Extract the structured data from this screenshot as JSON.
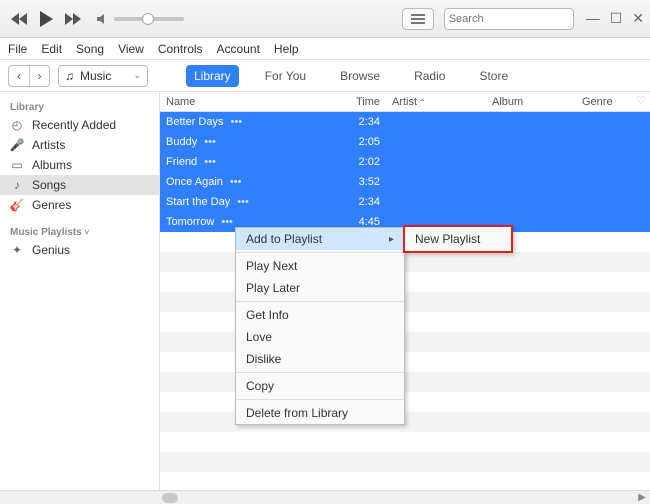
{
  "search": {
    "placeholder": "Search"
  },
  "menubar": [
    "File",
    "Edit",
    "Song",
    "View",
    "Controls",
    "Account",
    "Help"
  ],
  "source": {
    "label": "Music",
    "icon": "music-note-icon"
  },
  "tabs": [
    {
      "label": "Library",
      "active": true
    },
    {
      "label": "For You"
    },
    {
      "label": "Browse"
    },
    {
      "label": "Radio"
    },
    {
      "label": "Store"
    }
  ],
  "sidebar": {
    "sections": [
      {
        "header": "Library",
        "items": [
          {
            "icon": "clock-icon",
            "label": "Recently Added"
          },
          {
            "icon": "mic-icon",
            "label": "Artists"
          },
          {
            "icon": "album-icon",
            "label": "Albums"
          },
          {
            "icon": "note-icon",
            "label": "Songs",
            "active": true
          },
          {
            "icon": "guitar-icon",
            "label": "Genres"
          }
        ]
      },
      {
        "header": "Music Playlists",
        "collapsible": true,
        "items": [
          {
            "icon": "genius-icon",
            "label": "Genius"
          }
        ]
      }
    ]
  },
  "columns": {
    "name": "Name",
    "time": "Time",
    "artist": "Artist",
    "album": "Album",
    "genre": "Genre"
  },
  "sort_column": "artist",
  "tracks": [
    {
      "name": "Better Days",
      "time": "2:34",
      "selected": true
    },
    {
      "name": "Buddy",
      "time": "2:05",
      "selected": true
    },
    {
      "name": "Friend",
      "time": "2:02",
      "selected": true
    },
    {
      "name": "Once Again",
      "time": "3:52",
      "selected": true
    },
    {
      "name": "Start the Day",
      "time": "2:34",
      "selected": true
    },
    {
      "name": "Tomorrow",
      "time": "4:45",
      "selected": true
    }
  ],
  "context_menu": {
    "items": [
      {
        "label": "Add to Playlist",
        "submenu": true,
        "highlighted": true
      },
      "sep",
      {
        "label": "Play Next"
      },
      {
        "label": "Play Later"
      },
      "sep",
      {
        "label": "Get Info"
      },
      {
        "label": "Love"
      },
      {
        "label": "Dislike"
      },
      "sep",
      {
        "label": "Copy"
      },
      "sep",
      {
        "label": "Delete from Library"
      }
    ],
    "submenu": [
      {
        "label": "New Playlist"
      }
    ]
  }
}
